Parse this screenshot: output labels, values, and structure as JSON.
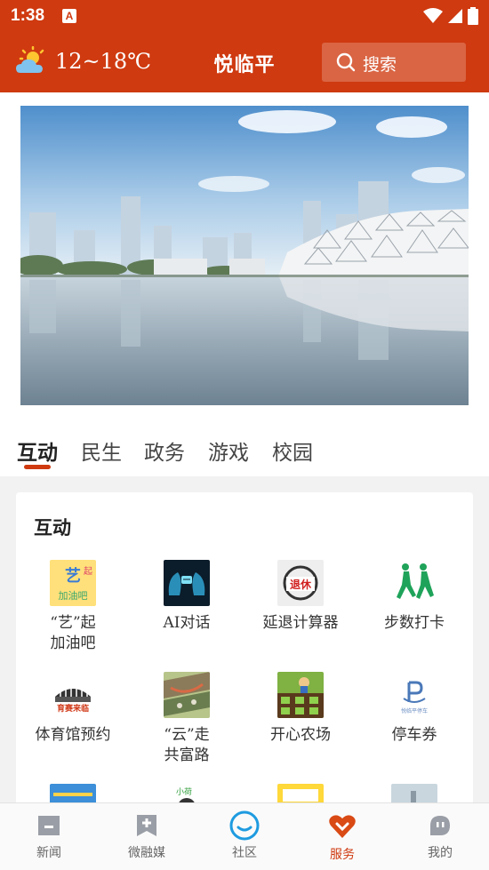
{
  "status_bar": {
    "time": "1:38",
    "app_icon_letter": "A"
  },
  "header": {
    "weather": "12~18℃",
    "title": "悦临平",
    "search_placeholder": "搜索"
  },
  "tabs": [
    {
      "label": "互动",
      "active": true
    },
    {
      "label": "民生",
      "active": false
    },
    {
      "label": "政务",
      "active": false
    },
    {
      "label": "游戏",
      "active": false
    },
    {
      "label": "校园",
      "active": false
    }
  ],
  "section": {
    "title": "互动",
    "items": [
      {
        "label_line1": "“艺”起",
        "label_line2": "加油吧",
        "icon": "yiqi-jiayouba-icon"
      },
      {
        "label_line1": "AI对话",
        "label_line2": "",
        "icon": "ai-chat-icon"
      },
      {
        "label_line1": "延退计算器",
        "label_line2": "",
        "icon": "retirement-calculator-icon"
      },
      {
        "label_line1": "步数打卡",
        "label_line2": "",
        "icon": "step-checkin-icon"
      },
      {
        "label_line1": "体育馆预约",
        "label_line2": "",
        "icon": "stadium-booking-icon"
      },
      {
        "label_line1": "“云”走",
        "label_line2": "共富路",
        "icon": "cloud-walk-icon"
      },
      {
        "label_line1": "开心农场",
        "label_line2": "",
        "icon": "happy-farm-icon"
      },
      {
        "label_line1": "停车券",
        "label_line2": "",
        "icon": "parking-coupon-icon"
      }
    ]
  },
  "bottom_nav": [
    {
      "label": "新闻",
      "icon": "news-icon",
      "active": false
    },
    {
      "label": "微融媒",
      "icon": "media-icon",
      "active": false
    },
    {
      "label": "社区",
      "icon": "community-icon",
      "active": false
    },
    {
      "label": "服务",
      "icon": "service-icon",
      "active": true
    },
    {
      "label": "我的",
      "icon": "profile-icon",
      "active": false
    }
  ],
  "colors": {
    "brand": "#cf3a10",
    "community_blue": "#1e9be0"
  }
}
